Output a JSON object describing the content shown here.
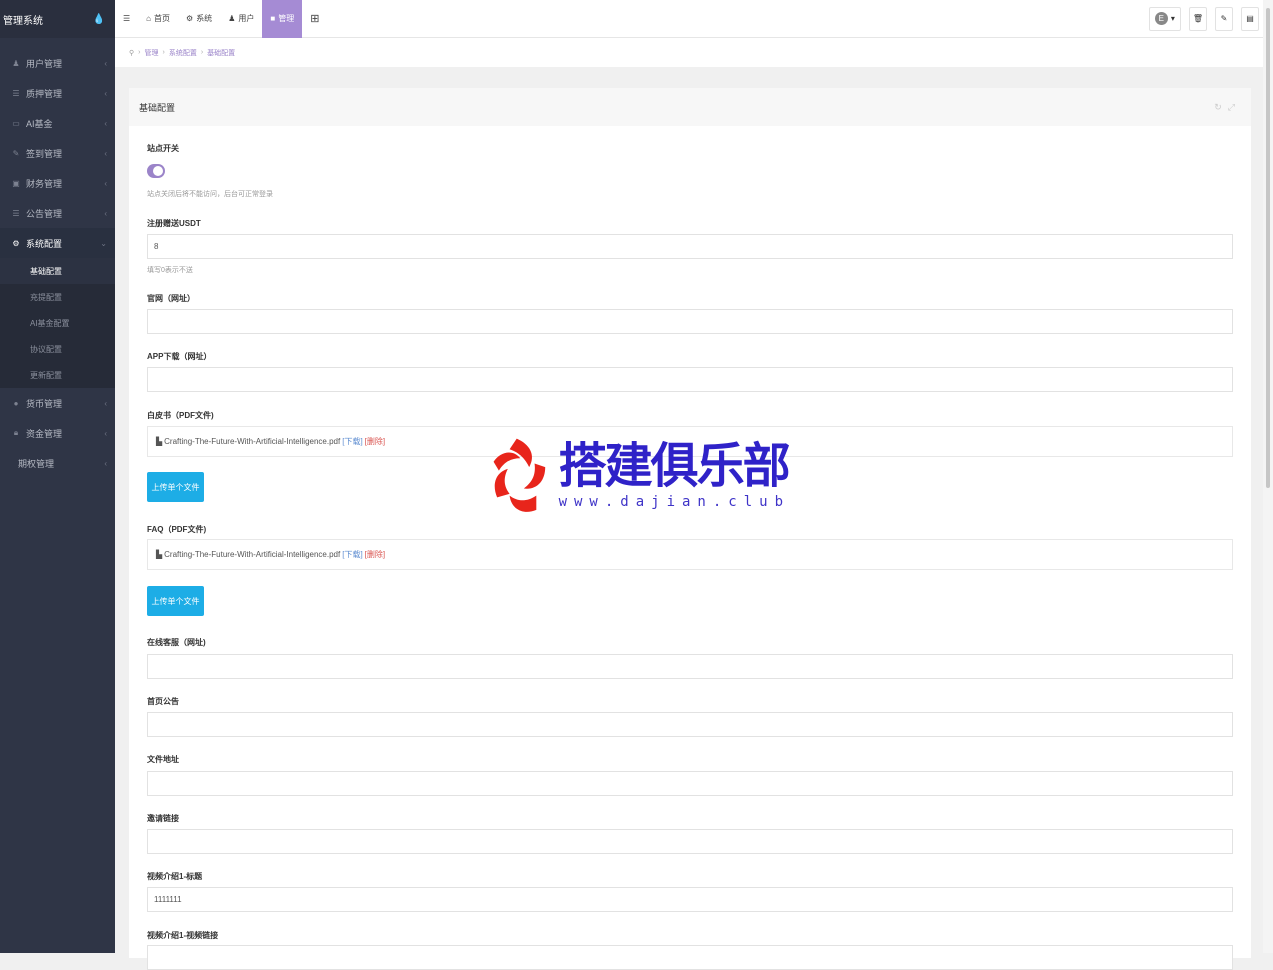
{
  "app": {
    "title": "管理系统"
  },
  "sidebar": {
    "items": [
      {
        "label": "用户管理",
        "icon": "user-icon"
      },
      {
        "label": "质押管理",
        "icon": "list-icon"
      },
      {
        "label": "AI基金",
        "icon": "monitor-icon"
      },
      {
        "label": "签到管理",
        "icon": "edit-icon"
      },
      {
        "label": "财务管理",
        "icon": "money-icon"
      },
      {
        "label": "公告管理",
        "icon": "list-icon"
      },
      {
        "label": "系统配置",
        "icon": "gears-icon"
      }
    ],
    "sub_items": [
      {
        "label": "基础配置"
      },
      {
        "label": "充提配置"
      },
      {
        "label": "AI基金配置"
      },
      {
        "label": "协议配置"
      },
      {
        "label": "更新配置"
      }
    ],
    "items_after": [
      {
        "label": "货币管理",
        "icon": "coin-icon"
      },
      {
        "label": "资金管理",
        "icon": "lock-icon"
      },
      {
        "label": "期权管理",
        "icon": ""
      }
    ]
  },
  "topbar": {
    "menu_icon": "☰",
    "tabs": [
      {
        "label": "首页",
        "icon": "home-icon",
        "glyph": "⌂"
      },
      {
        "label": "系统",
        "icon": "gear-icon",
        "glyph": "⚙"
      },
      {
        "label": "用户",
        "icon": "user-icon",
        "glyph": "♟"
      },
      {
        "label": "管理",
        "icon": "lock-icon",
        "glyph": "■"
      }
    ],
    "grid_icon": "⊞",
    "avatar_letter": "E"
  },
  "breadcrumb": {
    "items": [
      "管理",
      "系统配置",
      "基础配置"
    ]
  },
  "panel": {
    "title": "基础配置",
    "switch": {
      "label": "站点开关",
      "help": "站点关闭后将不能访问，后台可正常登录"
    },
    "register_usdt": {
      "label": "注册赠送USDT",
      "value": "8",
      "help": "填写0表示不送"
    },
    "website": {
      "label": "官网（网址）",
      "value": ""
    },
    "app_download": {
      "label": "APP下载（网址）",
      "value": ""
    },
    "whitepaper": {
      "label": "白皮书（PDF文件)",
      "file": "Crafting-The-Future-With-Artificial-Intelligence.pdf",
      "download": "[下载]",
      "delete": "[删除]",
      "upload": "上传单个文件"
    },
    "faq": {
      "label": "FAQ（PDF文件)",
      "file": "Crafting-The-Future-With-Artificial-Intelligence.pdf",
      "download": "[下载]",
      "delete": "[删除]",
      "upload": "上传单个文件"
    },
    "online_service": {
      "label": "在线客服（网址)",
      "value": ""
    },
    "home_notice": {
      "label": "首页公告",
      "value": ""
    },
    "file_address": {
      "label": "文件地址",
      "value": ""
    },
    "invite_link": {
      "label": "邀请链接",
      "value": ""
    },
    "video1_title": {
      "label": "视频介绍1-标题",
      "value": "1111111"
    },
    "video1_link": {
      "label": "视频介绍1-视频链接",
      "value": ""
    }
  },
  "watermark": {
    "cn": "搭建俱乐部",
    "url": "www.dajian.club"
  }
}
